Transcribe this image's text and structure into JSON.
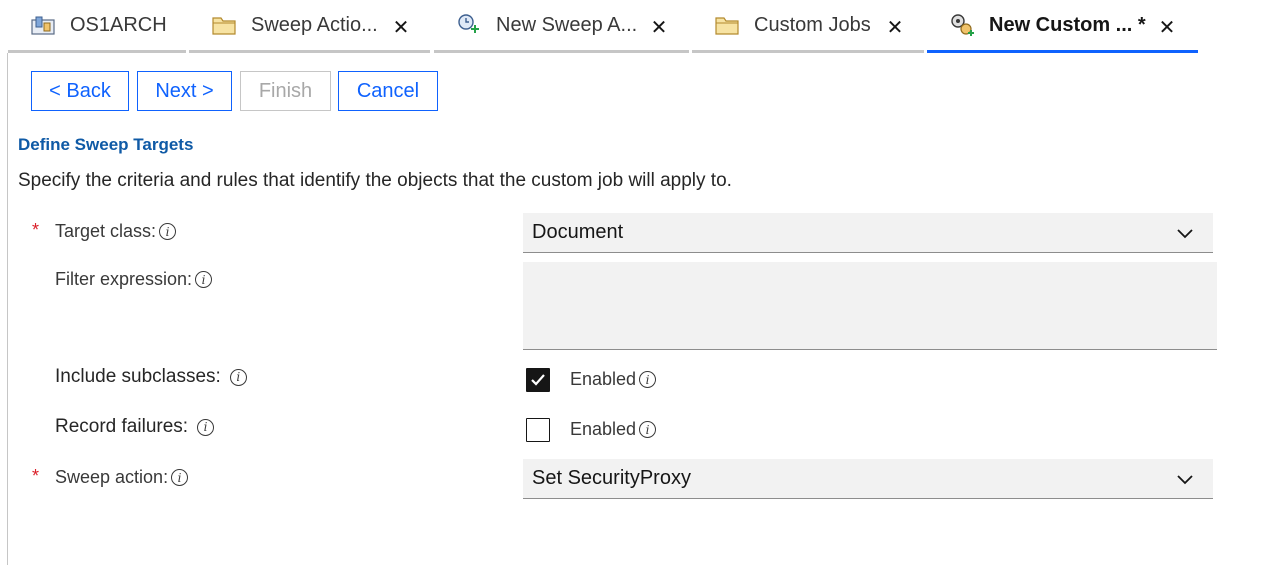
{
  "tabs": [
    {
      "label": "OS1ARCH",
      "icon": "object-store-icon",
      "closable": false,
      "active": false
    },
    {
      "label": "Sweep Actio...",
      "icon": "folder-icon",
      "closable": true,
      "active": false
    },
    {
      "label": "New Sweep A...",
      "icon": "new-sweep-action-icon",
      "closable": true,
      "active": false
    },
    {
      "label": "Custom Jobs",
      "icon": "folder-icon",
      "closable": true,
      "active": false
    },
    {
      "label": "New Custom ... *",
      "icon": "new-custom-job-icon",
      "closable": true,
      "active": true
    }
  ],
  "tab_close_glyph": "✕",
  "toolbar": {
    "back_label": "< Back",
    "next_label": "Next >",
    "finish_label": "Finish",
    "cancel_label": "Cancel"
  },
  "page": {
    "section_title": "Define Sweep Targets",
    "description": "Specify the criteria and rules that identify the objects that the custom job will apply to."
  },
  "form": {
    "required_marker": "*",
    "info_glyph": "i",
    "target_class": {
      "label": "Target class:",
      "value": "Document",
      "required": true
    },
    "filter_expression": {
      "label": "Filter expression:",
      "value": ""
    },
    "include_subclasses": {
      "label": "Include subclasses:",
      "checked": true,
      "option_label": "Enabled"
    },
    "record_failures": {
      "label": "Record failures:",
      "checked": false,
      "option_label": "Enabled"
    },
    "sweep_action": {
      "label": "Sweep action:",
      "value": "Set SecurityProxy",
      "required": true
    }
  },
  "colors": {
    "accent": "#0f62fe",
    "required": "#da1e28",
    "section_title": "#0f5aa6",
    "field_bg": "#f2f2f2"
  }
}
